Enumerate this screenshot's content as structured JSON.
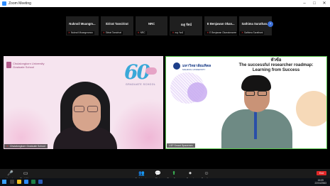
{
  "window": {
    "title": "Zoom Meeting",
    "controls": [
      "–",
      "□",
      "✕"
    ]
  },
  "thumbnails": [
    {
      "name": "Nuknoil Muangm...",
      "tag": "Nuknoil Muangmonoo"
    },
    {
      "name": "Sirirat Tansirirat",
      "tag": "Sirirat Tansirirat"
    },
    {
      "name": "NRC",
      "tag": "NRC"
    },
    {
      "name": "ณฐ รัตน์",
      "tag": "ณฐ รัตน์"
    },
    {
      "name": "E Benjawan Okan...",
      "tag": "E Benjawan Okanokmoree"
    },
    {
      "name": "Sathima Surathan...",
      "tag": "Sathima Surathani"
    }
  ],
  "left_pane": {
    "university": "Chulalongkorn University",
    "school": "Graduate School",
    "anniversary": "60",
    "anniversary_sub": "GRADUATE SCHOOL",
    "label": "Chulalongkorn Graduate School"
  },
  "right_pane": {
    "org_name": "มหาวิทยาลัยมหิดล",
    "org_sub": "MAHIDOL UNIVERSITY",
    "slide_line1": "หัวข้อ",
    "slide_line2": "The successful researcher roadmap:",
    "slide_line3": "Learning from Success",
    "label": "LSP Smart Spacemm"
  },
  "toolbar": {
    "items": [
      {
        "icon": "🎤",
        "label": "Unmute"
      },
      {
        "icon": "▭",
        "label": "Start Video"
      },
      {
        "icon": "👥",
        "label": "Participants"
      },
      {
        "icon": "💬",
        "label": "Chat"
      },
      {
        "icon": "⬆",
        "label": "Share Screen"
      },
      {
        "icon": "⏺",
        "label": "Record"
      },
      {
        "icon": "☺",
        "label": "Reactions"
      }
    ],
    "end_label": "End"
  },
  "taskbar": {
    "time": "15:09",
    "date": "22/04/2563"
  },
  "colors": {
    "accent_green": "#56c24b",
    "end_red": "#e02828",
    "zoom_blue": "#2d8cff"
  }
}
